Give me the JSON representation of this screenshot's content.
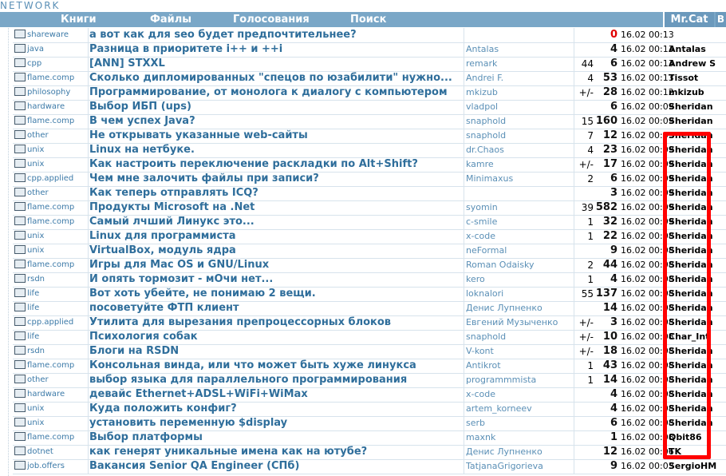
{
  "brand": "NETWORK",
  "nav": {
    "items": [
      {
        "label": "Книги"
      },
      {
        "label": "Файлы"
      },
      {
        "label": "Голосования"
      },
      {
        "label": "Поиск"
      }
    ],
    "user": "Mr.Cat",
    "right": "В"
  },
  "topics": [
    {
      "forum": "shareware",
      "title": "а вот как для seo будет предпочтительнее?",
      "author": "",
      "rating": "",
      "replies": "0",
      "date": "16.02 00:13",
      "last": ""
    },
    {
      "forum": "java",
      "title": "Разница в приоритете i++ и ++i",
      "author": "Antalas",
      "rating": "",
      "replies": "4",
      "date": "16.02 00:13",
      "last": "Antalas"
    },
    {
      "forum": "cpp",
      "title": "[ANN] STXXL",
      "author": "remark",
      "rating": "44",
      "replies": "6",
      "date": "16.02 00:13",
      "last": "Andrew S"
    },
    {
      "forum": "flame.comp",
      "title": "Сколько дипломированных \"спецов по юзабилити\" нужно...",
      "author": "Andrei F.",
      "rating": "4",
      "replies": "53",
      "date": "16.02 00:13",
      "last": "Tissot"
    },
    {
      "forum": "philosophy",
      "title": "Программирование, от монолога к диалогу с компьютером",
      "author": "mkizub",
      "rating": "+/-",
      "replies": "28",
      "date": "16.02 00:12",
      "last": "mkizub"
    },
    {
      "forum": "hardware",
      "title": "Выбор ИБП (ups)",
      "author": "vladpol",
      "rating": "",
      "replies": "6",
      "date": "16.02 00:09",
      "last": "Sheridan"
    },
    {
      "forum": "flame.comp",
      "title": "В чем успех Java?",
      "author": "snaphold",
      "rating": "15",
      "replies": "160",
      "date": "16.02 00:09",
      "last": "Sheridan"
    },
    {
      "forum": "other",
      "title": "Не открывать указанные web-сайты",
      "author": "snaphold",
      "rating": "7",
      "replies": "12",
      "date": "16.02 00:09",
      "last": "Sheridan"
    },
    {
      "forum": "unix",
      "title": "Linux на нетбуке.",
      "author": "dr.Chaos",
      "rating": "4",
      "replies": "23",
      "date": "16.02 00:09",
      "last": "Sheridan"
    },
    {
      "forum": "unix",
      "title": "Как настроить переключение раскладки по Alt+Shift?",
      "author": "kamre",
      "rating": "+/-",
      "replies": "17",
      "date": "16.02 00:09",
      "last": "Sheridan"
    },
    {
      "forum": "cpp.applied",
      "title": "Чем мне залочить файлы при записи?",
      "author": "Minimaxus",
      "rating": "2",
      "replies": "6",
      "date": "16.02 00:09",
      "last": "Sheridan"
    },
    {
      "forum": "other",
      "title": "Как теперь отправлять ICQ?",
      "author": "",
      "rating": "",
      "replies": "3",
      "date": "16.02 00:09",
      "last": "Sheridan"
    },
    {
      "forum": "flame.comp",
      "title": "Продукты Microsoft на .Net",
      "author": "syomin",
      "rating": "39",
      "replies": "582",
      "date": "16.02 00:09",
      "last": "Sheridan"
    },
    {
      "forum": "flame.comp",
      "title": "Самый лчший Линукс это...",
      "author": "c-smile",
      "rating": "1",
      "replies": "32",
      "date": "16.02 00:09",
      "last": "Sheridan"
    },
    {
      "forum": "unix",
      "title": "Linux для программиста",
      "author": "x-code",
      "rating": "1",
      "replies": "22",
      "date": "16.02 00:08",
      "last": "Sheridan"
    },
    {
      "forum": "unix",
      "title": "VirtualBox, модуль ядра",
      "author": "neFormal",
      "rating": "",
      "replies": "9",
      "date": "16.02 00:08",
      "last": "Sheridan"
    },
    {
      "forum": "flame.comp",
      "title": "Игры для Mac OS и GNU/Linux",
      "author": "Roman Odaisky",
      "rating": "2",
      "replies": "44",
      "date": "16.02 00:08",
      "last": "Sheridan"
    },
    {
      "forum": "rsdn",
      "title": "И опять тормозит - мОчи нет...",
      "author": "kero",
      "rating": "1",
      "replies": "4",
      "date": "16.02 00:08",
      "last": "Sheridan"
    },
    {
      "forum": "life",
      "title": "Вот хоть убейте, не понимаю 2 вещи.",
      "author": "loknalori",
      "rating": "55",
      "replies": "137",
      "date": "16.02 00:08",
      "last": "Sheridan"
    },
    {
      "forum": "life",
      "title": "посоветуйте ФТП клиент",
      "author": "Денис Лупненко",
      "rating": "",
      "replies": "14",
      "date": "16.02 00:08",
      "last": "Sheridan"
    },
    {
      "forum": "cpp.applied",
      "title": "Утилита для вырезания препроцессорных блоков",
      "author": "Евгений Музыченко",
      "rating": "+/-",
      "replies": "3",
      "date": "16.02 00:08",
      "last": "Sheridan"
    },
    {
      "forum": "life",
      "title": "Психология собак",
      "author": "snaphold",
      "rating": "+/-",
      "replies": "10",
      "date": "16.02 00:08",
      "last": "Char_Int"
    },
    {
      "forum": "rsdn",
      "title": "Блоги на RSDN",
      "author": "V-kont",
      "rating": "+/-",
      "replies": "18",
      "date": "16.02 00:08",
      "last": "Sheridan"
    },
    {
      "forum": "flame.comp",
      "title": "Консольная винда, или что может быть хуже линукса",
      "author": "Antikrot",
      "rating": "1",
      "replies": "43",
      "date": "16.02 00:08",
      "last": "Sheridan"
    },
    {
      "forum": "other",
      "title": "выбор языка для параллельного программирования",
      "author": "programmmista",
      "rating": "1",
      "replies": "14",
      "date": "16.02 00:08",
      "last": "Sheridan"
    },
    {
      "forum": "hardware",
      "title": "девайс Ethernet+ADSL+WiFi+WiMax",
      "author": "x-code",
      "rating": "",
      "replies": "4",
      "date": "16.02 00:08",
      "last": "Sheridan"
    },
    {
      "forum": "unix",
      "title": "Куда положить конфиг?",
      "author": "artem_korneev",
      "rating": "",
      "replies": "4",
      "date": "16.02 00:08",
      "last": "Sheridan"
    },
    {
      "forum": "unix",
      "title": "установить переменную $display",
      "author": "serb",
      "rating": "",
      "replies": "6",
      "date": "16.02 00:08",
      "last": "Sheridan"
    },
    {
      "forum": "flame.comp",
      "title": "Выбор платформы",
      "author": "maxnk",
      "rating": "",
      "replies": "1",
      "date": "16.02 00:08",
      "last": "Qbit86"
    },
    {
      "forum": "dotnet",
      "title": "как генерят уникальные имена как на ютубе?",
      "author": "Денис Лупненко",
      "rating": "",
      "replies": "12",
      "date": "16.02 00:06",
      "last": "TK"
    },
    {
      "forum": "job.offers",
      "title": "Вакансия Senior QA Engineer (СПб)",
      "author": "TatjanaGrigorieva",
      "rating": "",
      "replies": "9",
      "date": "16.02 00:03",
      "last": "SergioHM"
    }
  ]
}
